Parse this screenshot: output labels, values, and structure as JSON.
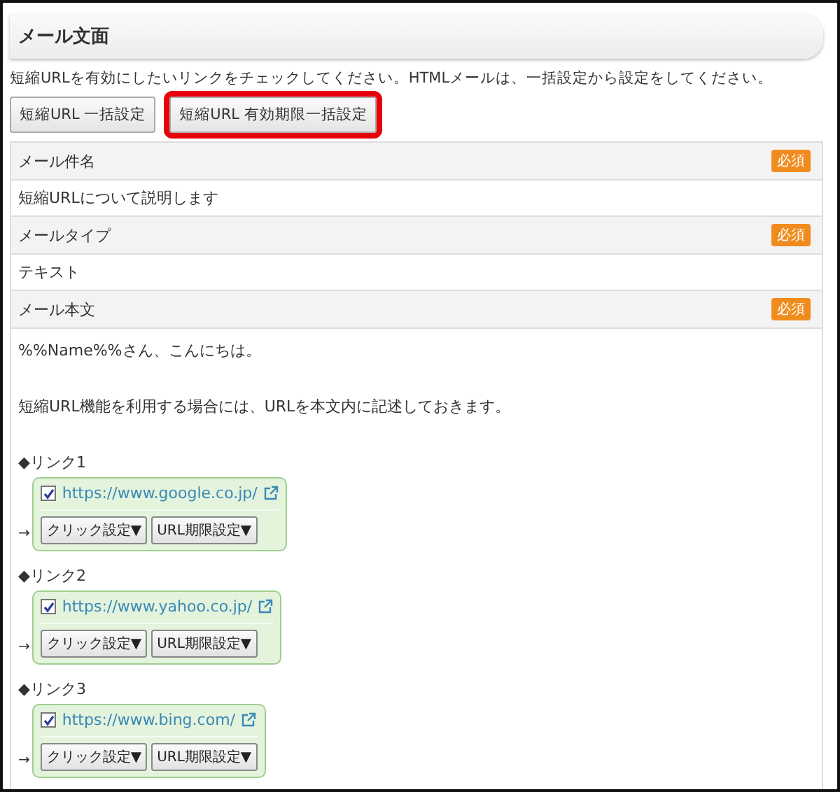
{
  "section_title": "メール文面",
  "instruction": "短縮URLを有効にしたいリンクをチェックしてください。HTMLメールは、一括設定から設定をしてください。",
  "buttons": [
    {
      "label": "短縮URL 一括設定",
      "highlighted": false
    },
    {
      "label": "短縮URL 有効期限一括設定",
      "highlighted": true
    }
  ],
  "fields": [
    {
      "label": "メール件名",
      "badge": "必須",
      "value": "短縮URLについて説明します"
    },
    {
      "label": "メールタイプ",
      "badge": "必須",
      "value": "テキスト"
    },
    {
      "label": "メール本文",
      "badge": "必須"
    }
  ],
  "body": {
    "lines": [
      "%%Name%%さん、こんにちは。",
      "短縮URL機能を利用する場合には、URLを本文内に記述しておきます。"
    ],
    "links": [
      {
        "label": "◆リンク1",
        "url": "https://www.google.co.jp/",
        "checked": true,
        "arrow": "→",
        "buttons": [
          "クリック設定▼",
          "URL期限設定▼"
        ]
      },
      {
        "label": "◆リンク2",
        "url": "https://www.yahoo.co.jp/",
        "checked": true,
        "arrow": "→",
        "buttons": [
          "クリック設定▼",
          "URL期限設定▼"
        ]
      },
      {
        "label": "◆リンク3",
        "url": "https://www.bing.com/",
        "checked": true,
        "arrow": "→",
        "buttons": [
          "クリック設定▼",
          "URL期限設定▼"
        ]
      }
    ]
  }
}
